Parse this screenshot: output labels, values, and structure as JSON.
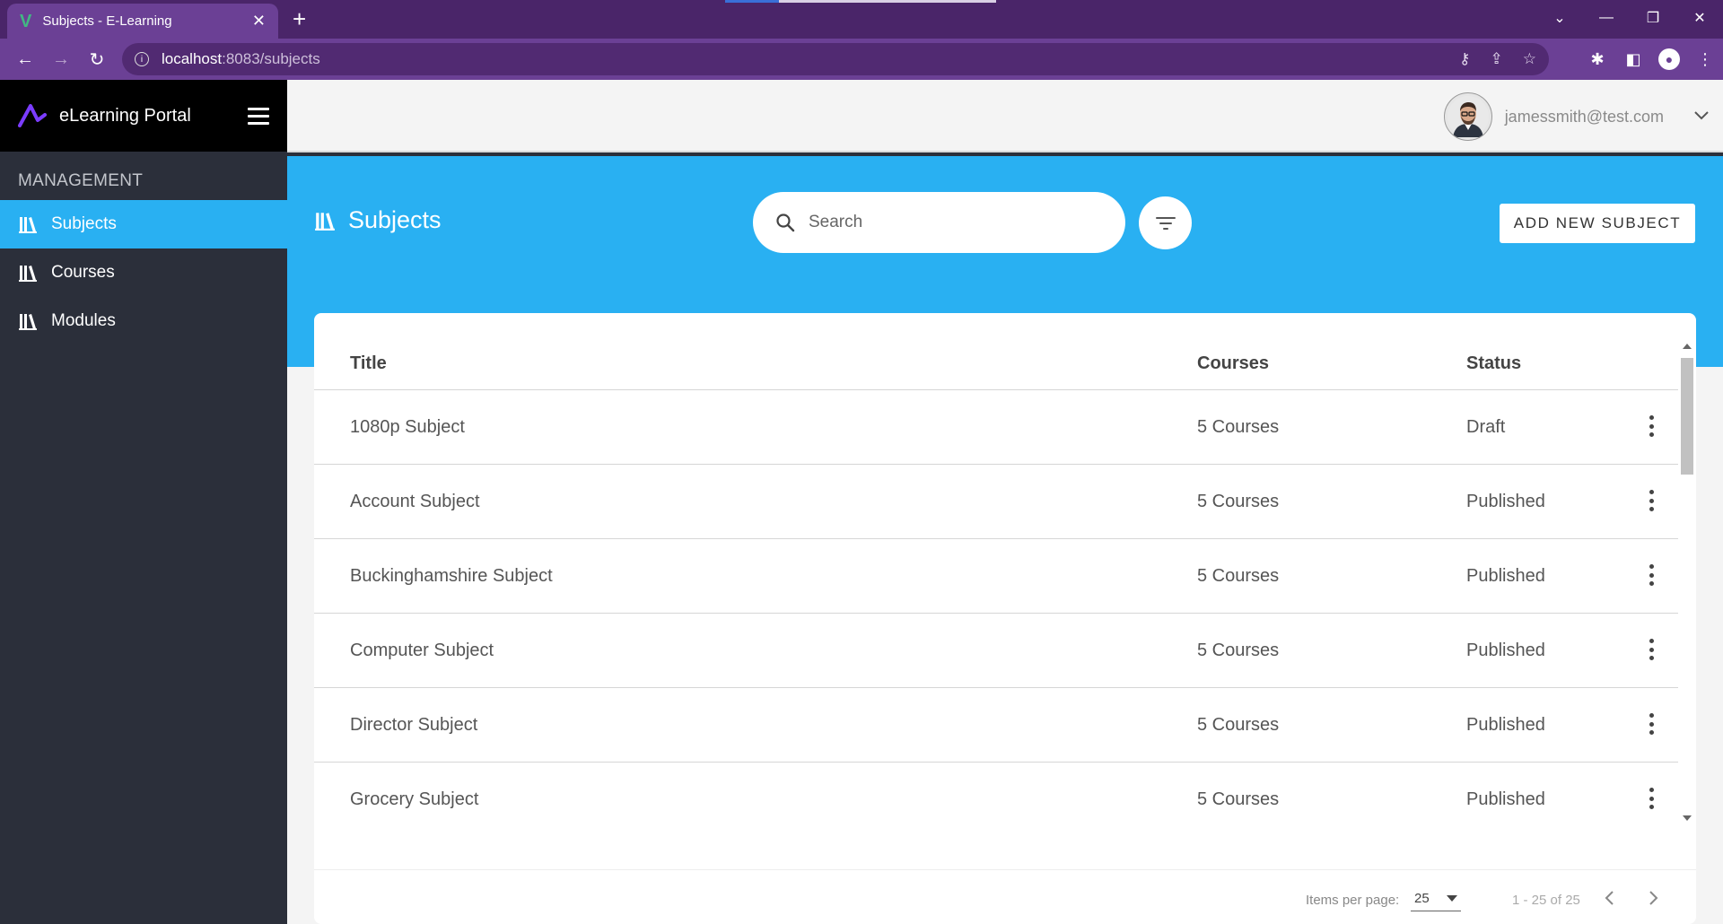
{
  "browser": {
    "tab_title": "Subjects - E-Learning",
    "url_host": "localhost",
    "url_path": ":8083/subjects"
  },
  "sidebar": {
    "brand": "eLearning Portal",
    "section": "MANAGEMENT",
    "items": [
      {
        "label": "Subjects",
        "active": true
      },
      {
        "label": "Courses",
        "active": false
      },
      {
        "label": "Modules",
        "active": false
      }
    ]
  },
  "topbar": {
    "user_email": "jamessmith@test.com"
  },
  "header": {
    "title": "Subjects",
    "search_placeholder": "Search",
    "add_button": "ADD NEW SUBJECT"
  },
  "table": {
    "columns": [
      "Title",
      "Courses",
      "Status"
    ],
    "rows": [
      {
        "title": "1080p Subject",
        "courses": "5 Courses",
        "status": "Draft"
      },
      {
        "title": "Account Subject",
        "courses": "5 Courses",
        "status": "Published"
      },
      {
        "title": "Buckinghamshire Subject",
        "courses": "5 Courses",
        "status": "Published"
      },
      {
        "title": "Computer Subject",
        "courses": "5 Courses",
        "status": "Published"
      },
      {
        "title": "Director Subject",
        "courses": "5 Courses",
        "status": "Published"
      },
      {
        "title": "Grocery Subject",
        "courses": "5 Courses",
        "status": "Published"
      }
    ]
  },
  "paginator": {
    "items_per_page_label": "Items per page:",
    "page_size": "25",
    "range": "1 - 25 of 25"
  },
  "colors": {
    "accent": "#29b0f2",
    "sidebar": "#2b2f3a",
    "browser_frame": "#6b4095"
  }
}
